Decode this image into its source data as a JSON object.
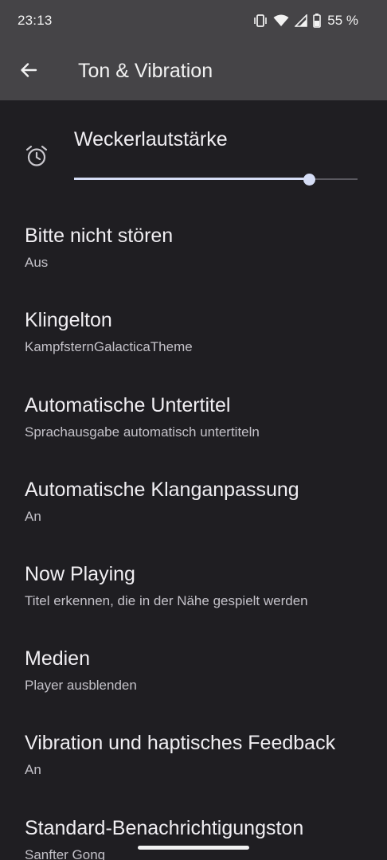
{
  "status_bar": {
    "time": "23:13",
    "battery_percent": "55 %",
    "icons": [
      "vibrate-icon",
      "wifi-icon",
      "signal-icon",
      "battery-icon"
    ]
  },
  "app_bar": {
    "title": "Ton & Vibration",
    "back_icon": "arrow-back-icon"
  },
  "volume": {
    "label": "Weckerlautstärke",
    "icon": "alarm-clock-icon",
    "level": 0.83
  },
  "settings": [
    {
      "title": "Bitte nicht stören",
      "subtitle": "Aus"
    },
    {
      "title": "Klingelton",
      "subtitle": "KampfsternGalacticaTheme"
    },
    {
      "title": "Automatische Untertitel",
      "subtitle": "Sprachausgabe automatisch untertiteln"
    },
    {
      "title": "Automatische Klanganpassung",
      "subtitle": "An"
    },
    {
      "title": "Now Playing",
      "subtitle": "Titel erkennen, die in der Nähe gespielt werden"
    },
    {
      "title": "Medien",
      "subtitle": "Player ausblenden"
    },
    {
      "title": "Vibration und haptisches Feedback",
      "subtitle": "An"
    },
    {
      "title": "Standard-Benachrichtigungston",
      "subtitle": "Sanfter Gong"
    }
  ],
  "colors": {
    "background": "#1f1e22",
    "app_bar": "#454447",
    "accent": "#d5ddf5"
  }
}
